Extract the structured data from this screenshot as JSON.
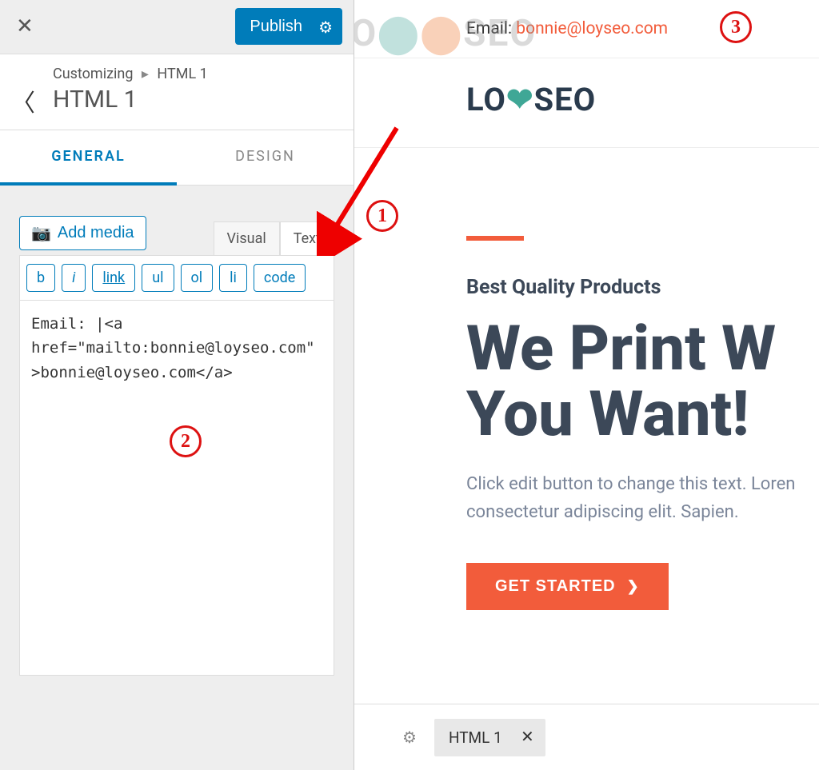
{
  "topbar": {
    "publish_label": "Publish"
  },
  "breadcrumb": {
    "root": "Customizing",
    "parent": "HTML 1",
    "title": "HTML 1"
  },
  "tabs": {
    "general": "GENERAL",
    "design": "DESIGN"
  },
  "editor": {
    "add_media": "Add media",
    "tab_visual": "Visual",
    "tab_text": "Text",
    "btn_b": "b",
    "btn_i": "i",
    "btn_link": "link",
    "btn_ul": "ul",
    "btn_ol": "ol",
    "btn_li": "li",
    "btn_code": "code",
    "content": "Email: |<a href=\"mailto:bonnie@loyseo.com\">bonnie@loyseo.com</a>"
  },
  "preview": {
    "watermark": "LO  SEO",
    "email_label": "Email: ",
    "email_value": "bonnie@loyseo.com",
    "logo": "LO  SEO",
    "hero_sub": "Best Quality Products",
    "hero_title_l1": "We Print W",
    "hero_title_l2": "You Want!",
    "hero_desc_l1": "Click edit button to change this text. Loren",
    "hero_desc_l2": "consectetur adipiscing elit. Sapien.",
    "cta": "GET STARTED"
  },
  "builder": {
    "chip_label": "HTML 1"
  },
  "annotations": {
    "a1": "1",
    "a2": "2",
    "a3": "3"
  }
}
